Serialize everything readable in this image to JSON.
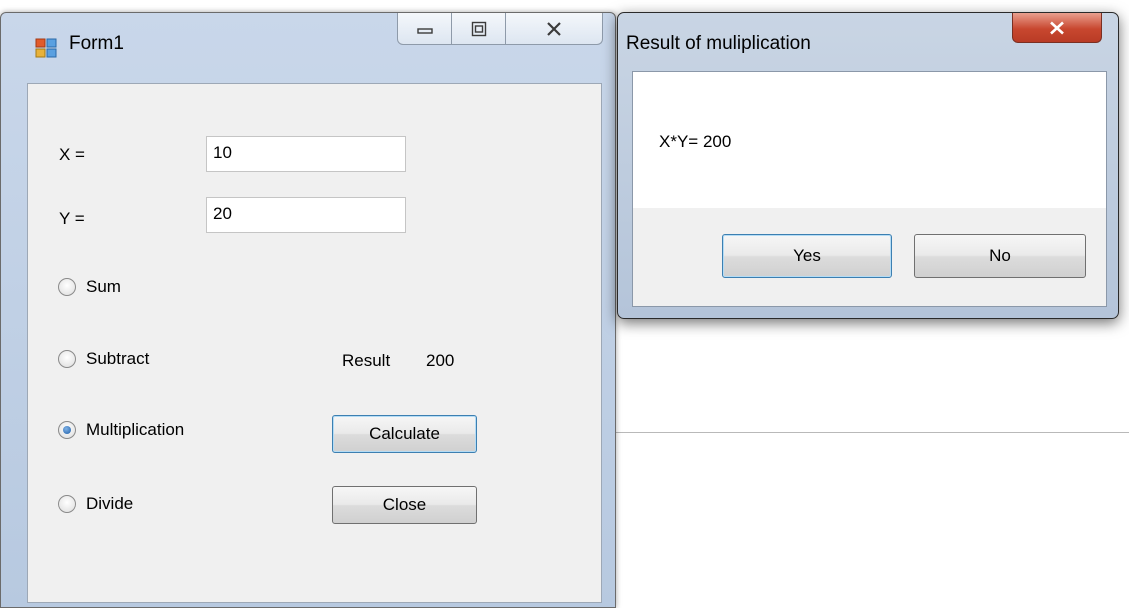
{
  "form1": {
    "title": "Form1",
    "x_label": "X =",
    "x_value": "10",
    "y_label": "Y =",
    "y_value": "20",
    "radios": [
      {
        "label": "Sum",
        "checked": false
      },
      {
        "label": "Subtract",
        "checked": false
      },
      {
        "label": "Multiplication",
        "checked": true
      },
      {
        "label": "Divide",
        "checked": false
      }
    ],
    "result_label": "Result",
    "result_value": "200",
    "calculate_label": "Calculate",
    "close_label": "Close"
  },
  "message_box": {
    "title": "Result of muliplication",
    "text": "X*Y= 200",
    "yes_label": "Yes",
    "no_label": "No"
  },
  "colors": {
    "title_bar": "#c9d7ea",
    "client_bg": "#f0f0f0",
    "close_red": "#c8472f",
    "radio_checked": "#1e5ea8"
  }
}
